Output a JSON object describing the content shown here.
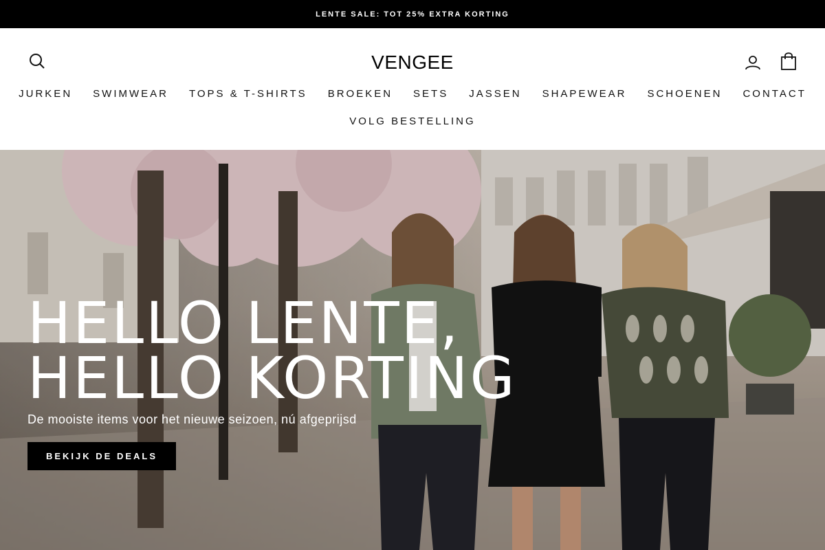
{
  "announcement": {
    "text": "LENTE SALE: TOT 25% EXTRA KORTING"
  },
  "header": {
    "logo": "VENGEE",
    "icons": {
      "search": "search-icon",
      "account": "user-icon",
      "cart": "shopping-bag-icon"
    }
  },
  "nav": {
    "items": [
      {
        "label": "JURKEN"
      },
      {
        "label": "SWIMWEAR"
      },
      {
        "label": "TOPS & T-SHIRTS"
      },
      {
        "label": "BROEKEN"
      },
      {
        "label": "SETS"
      },
      {
        "label": "JASSEN"
      },
      {
        "label": "SHAPEWEAR"
      },
      {
        "label": "SCHOENEN"
      },
      {
        "label": "CONTACT"
      },
      {
        "label": "VOLG BESTELLING"
      }
    ]
  },
  "hero": {
    "title_line1": "HELLO LENTE,",
    "title_line2": "HELLO KORTING",
    "subtitle": "De mooiste items voor het nieuwe seizoen, nú afgeprijsd",
    "cta_label": "BEKIJK DE DEALS"
  },
  "colors": {
    "announcement_bg": "#000000",
    "cta_bg": "#000000",
    "text_light": "#ffffff"
  }
}
